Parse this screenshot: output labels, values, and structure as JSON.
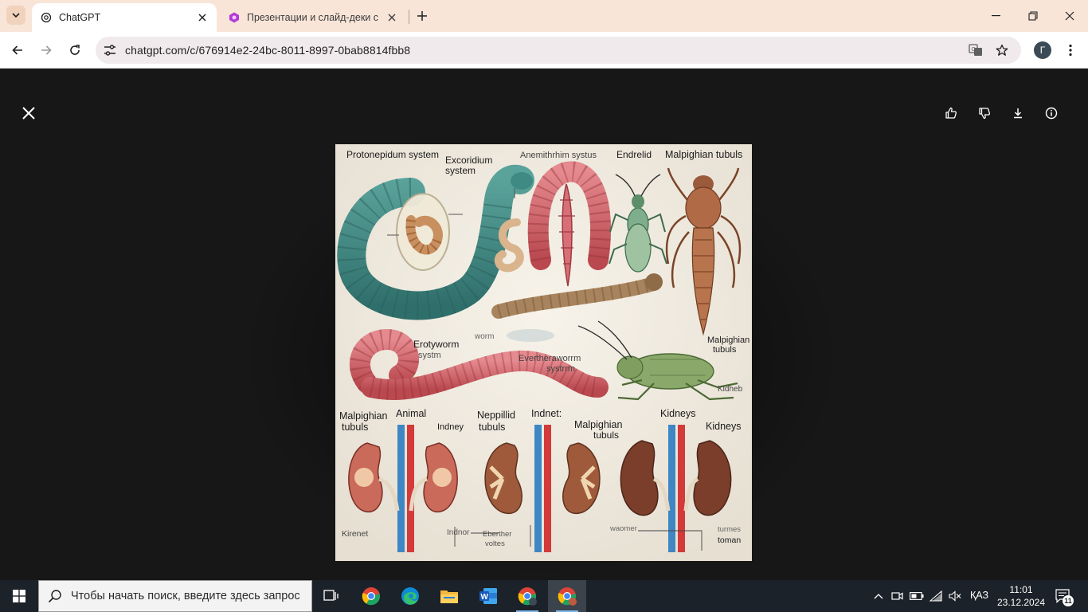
{
  "browser": {
    "tabs": [
      {
        "title": "ChatGPT",
        "active": true
      },
      {
        "title": "Презентации и слайд-деки с AI",
        "active": false
      }
    ],
    "url": "chatgpt.com/c/676914e2-24bc-8011-8997-0bab8814fbb8",
    "profile_initial": "Г"
  },
  "image_labels": {
    "protonephridium": "Protonepidum system",
    "excretory_1": "Excoridium",
    "excretory_2": "system",
    "anemithrim": "Anemithrhim systus",
    "endrelid": "Endrelid",
    "malpighian_top": "Malpighian tubuls",
    "earthworm_1": "Erotyworm",
    "earthworm_2": "systm",
    "worm": "worm",
    "eretherwarm_1": "Evertheraworrm",
    "eretherwarm_2": "systrrm",
    "malp_right_1": "Malpighian",
    "malp_right_2": "tubuls",
    "kidhes": "Kidheb",
    "bl_malp_1": "Malpighian",
    "bl_malp_2": "tubuls",
    "animal": "Animal",
    "indney": "Indney",
    "nephilid_1": "Neppillid",
    "nephilid_2": "tubuls",
    "indnet": "Indnet:",
    "malp_mid_1": "Malpighian",
    "malp_mid_2": "tubuls",
    "kidneys_1": "Kidneys",
    "kidneys_2": "Kidneys",
    "kirenet": "Kirenet",
    "indnor": "Indnor",
    "eberther_1": "Eberther",
    "eberther_2": "voltes",
    "waomer": "waomer",
    "turmes": "turmes",
    "toman": "toman"
  },
  "taskbar": {
    "search_placeholder": "Чтобы начать поиск, введите здесь запрос",
    "language": "ҚАЗ",
    "time": "11:01",
    "date": "23.12.2024",
    "notifications": "11"
  }
}
